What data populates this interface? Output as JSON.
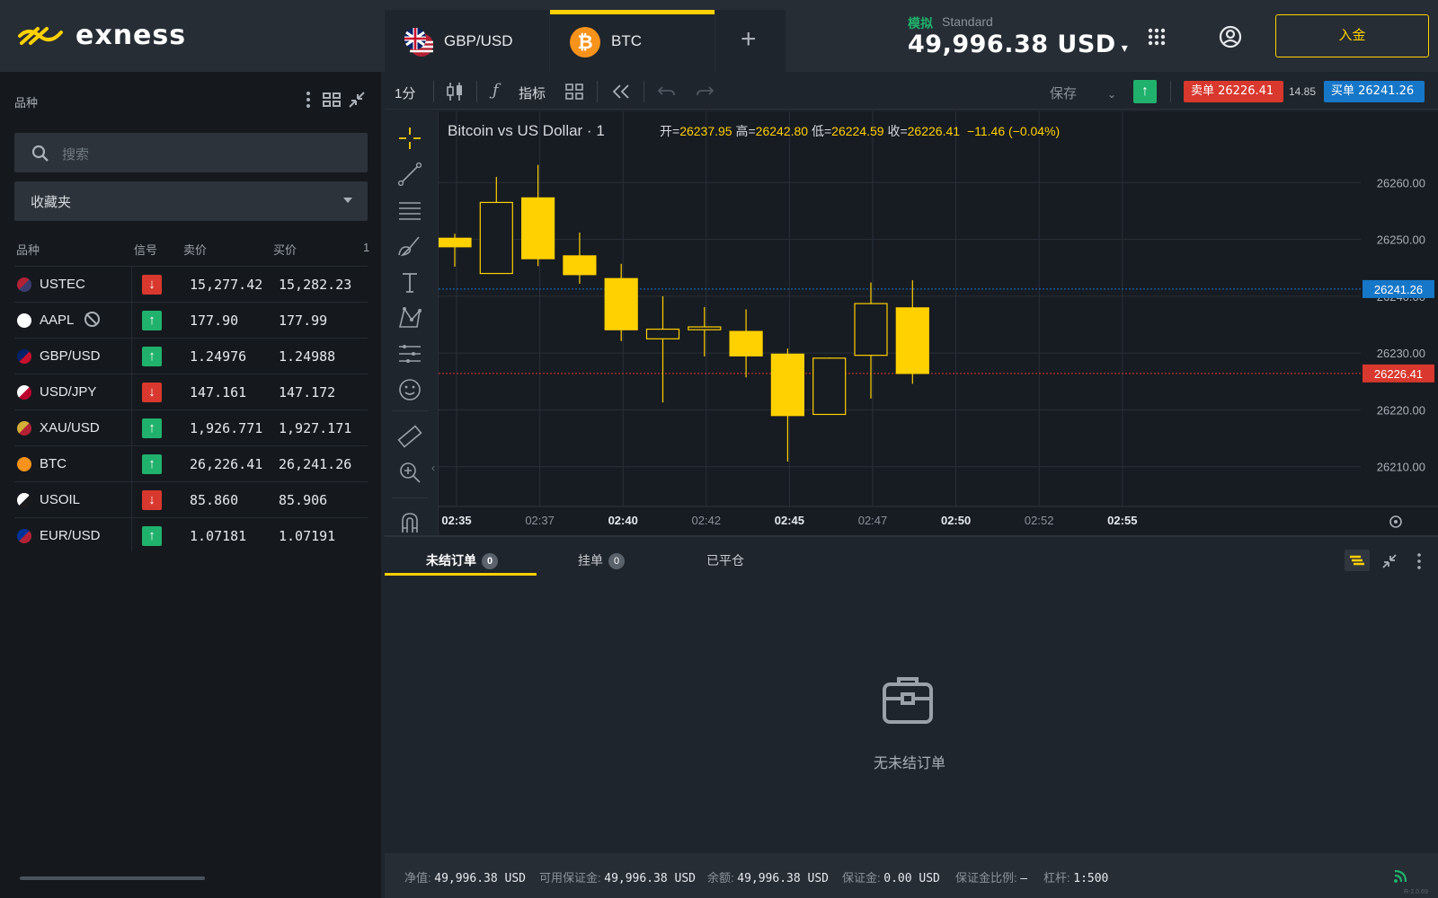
{
  "app": {
    "logo_text": "exness"
  },
  "sidebar": {
    "title": "品种",
    "search_placeholder": "搜索",
    "favorites_label": "收藏夹",
    "columns": {
      "symbol": "品种",
      "signal": "信号",
      "bid": "卖价",
      "ask": "买价",
      "count": "1"
    },
    "rows": [
      {
        "symbol": "USTEC",
        "signal": "down",
        "bid": "15,277.42",
        "ask": "15,282.23",
        "flag": "us",
        "blocked": false
      },
      {
        "symbol": "AAPL",
        "signal": "up",
        "bid": "177.90",
        "ask": "177.99",
        "flag": "apple",
        "blocked": true
      },
      {
        "symbol": "GBP/USD",
        "signal": "up",
        "bid": "1.24976",
        "ask": "1.24988",
        "flag": "gb-us",
        "blocked": false
      },
      {
        "symbol": "USD/JPY",
        "signal": "down",
        "bid": "147.161",
        "ask": "147.172",
        "flag": "us-jp",
        "blocked": false
      },
      {
        "symbol": "XAU/USD",
        "signal": "up",
        "bid": "1,926.771",
        "ask": "1,927.171",
        "flag": "gold",
        "blocked": false
      },
      {
        "symbol": "BTC",
        "signal": "up",
        "bid": "26,226.41",
        "ask": "26,241.26",
        "flag": "btc",
        "blocked": false
      },
      {
        "symbol": "USOIL",
        "signal": "down",
        "bid": "85.860",
        "ask": "85.906",
        "flag": "oil",
        "blocked": false
      },
      {
        "symbol": "EUR/USD",
        "signal": "up",
        "bid": "1.07181",
        "ask": "1.07191",
        "flag": "eu-us",
        "blocked": false
      }
    ]
  },
  "topbar": {
    "tabs": [
      {
        "label": "GBP/USD",
        "active": false
      },
      {
        "label": "BTC",
        "active": true
      }
    ],
    "add_tab": "+",
    "account_mode": "模拟",
    "account_type": "Standard",
    "balance": "49,996.38 USD",
    "deposit_label": "入金"
  },
  "toolbar": {
    "timeframe": "1分",
    "indicators_label": "指标",
    "save_label": "保存",
    "sell_label": "卖单 26226.41",
    "spread": "14.85",
    "buy_label": "买单 26241.26"
  },
  "chart": {
    "title": "Bitcoin vs US Dollar · 1",
    "ohlc": {
      "o_label": "开=",
      "o": "26237.95",
      "h_label": "高=",
      "h": "26242.80",
      "l_label": "低=",
      "l": "26224.59",
      "c_label": "收=",
      "c": "26226.41",
      "change": "−11.46 (−0.04%)"
    },
    "price_labels": [
      "26260.00",
      "26250.00",
      "26240.00",
      "26230.00",
      "26220.00",
      "26210.00"
    ],
    "ask_tag": "26241.26",
    "bid_tag": "26226.41",
    "time_labels": [
      {
        "t": "02:35",
        "bold": true
      },
      {
        "t": "02:37",
        "bold": false
      },
      {
        "t": "02:40",
        "bold": true
      },
      {
        "t": "02:42",
        "bold": false
      },
      {
        "t": "02:45",
        "bold": true
      },
      {
        "t": "02:47",
        "bold": false
      },
      {
        "t": "02:50",
        "bold": true
      },
      {
        "t": "02:52",
        "bold": false
      },
      {
        "t": "02:55",
        "bold": true
      }
    ],
    "colors": {
      "candle": "#ffd100",
      "ask_line": "#1677c8",
      "bid_line": "#d8382d"
    }
  },
  "chart_data": {
    "type": "candlestick",
    "title": "Bitcoin vs US Dollar · 1",
    "ylim": [
      26203,
      26270
    ],
    "candles": [
      {
        "o": 26250.2,
        "h": 26251.0,
        "l": 26245.2,
        "c": 26248.7
      },
      {
        "o": 26244.0,
        "h": 26261.0,
        "l": 26245.0,
        "c": 26256.5
      },
      {
        "o": 26257.3,
        "h": 26263.1,
        "l": 26245.3,
        "c": 26246.6
      },
      {
        "o": 26247.1,
        "h": 26251.2,
        "l": 26242.2,
        "c": 26243.8
      },
      {
        "o": 26243.1,
        "h": 26245.7,
        "l": 26232.1,
        "c": 26234.1
      },
      {
        "o": 26232.5,
        "h": 26240.0,
        "l": 26221.3,
        "c": 26234.2
      },
      {
        "o": 26234.1,
        "h": 26238.1,
        "l": 26229.4,
        "c": 26234.6
      },
      {
        "o": 26233.8,
        "h": 26237.7,
        "l": 26225.7,
        "c": 26229.5
      },
      {
        "o": 26229.8,
        "h": 26230.8,
        "l": 26210.9,
        "c": 26219.0
      },
      {
        "o": 26219.2,
        "h": 26229.2,
        "l": 26220.0,
        "c": 26229.1
      },
      {
        "o": 26229.6,
        "h": 26242.4,
        "l": 26222.0,
        "c": 26238.7
      },
      {
        "o": 26237.95,
        "h": 26242.8,
        "l": 26224.59,
        "c": 26226.41
      }
    ]
  },
  "orders": {
    "tabs": [
      {
        "label": "未结订单",
        "count": "0"
      },
      {
        "label": "挂单",
        "count": "0"
      },
      {
        "label": "已平仓"
      }
    ],
    "empty_text": "无未结订单"
  },
  "status": {
    "equity_label": "净值:",
    "equity": "49,996.38 USD",
    "free_margin_label": "可用保证金:",
    "free_margin": "49,996.38 USD",
    "balance_label": "余额:",
    "balance": "49,996.38 USD",
    "margin_label": "保证金:",
    "margin": "0.00 USD",
    "margin_level_label": "保证金比例:",
    "margin_level": "–",
    "leverage_label": "杠杆:",
    "leverage": "1:500"
  },
  "version": "R-2.0.69"
}
